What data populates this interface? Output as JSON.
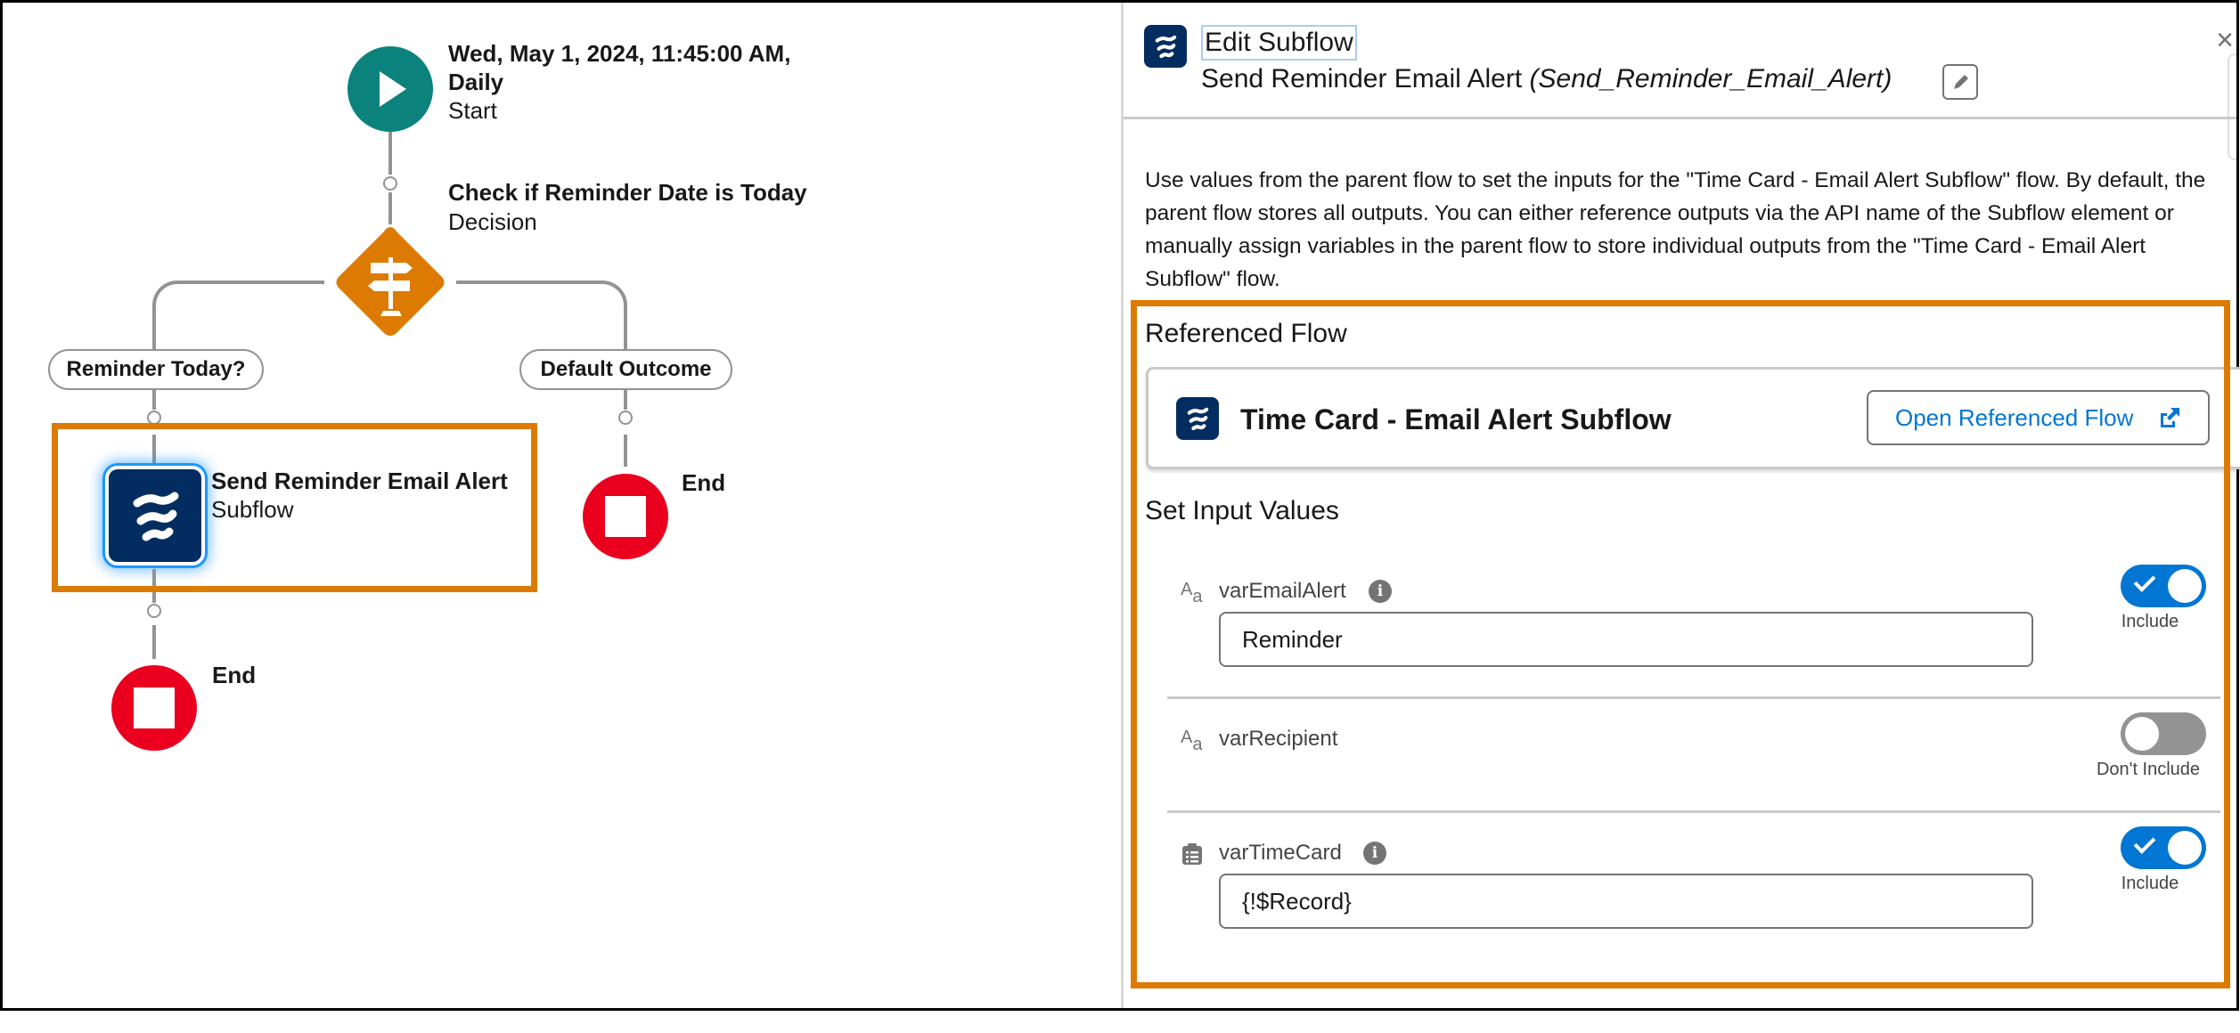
{
  "canvas": {
    "start": {
      "title_line1": "Wed, May 1, 2024, 11:45:00 AM,",
      "title_line2": "Daily",
      "type": "Start"
    },
    "decision": {
      "title": "Check if Reminder Date is Today",
      "type": "Decision"
    },
    "outcomes": [
      {
        "label": "Reminder Today?"
      },
      {
        "label": "Default Outcome"
      }
    ],
    "subflow": {
      "title": "Send Reminder Email Alert",
      "type": "Subflow",
      "highlighted": true
    },
    "end_right": {
      "label": "End"
    },
    "end_bottom": {
      "label": "End"
    }
  },
  "panel": {
    "title": "Edit Subflow",
    "element_label": "Send Reminder Email Alert",
    "element_api_name": "(Send_Reminder_Email_Alert)",
    "close_label": "×",
    "description": "Use values from the parent flow to set the inputs for the \"Time Card - Email Alert Subflow\" flow. By default, the parent flow stores all outputs. You can either reference outputs via the API name of the Subflow element or manually assign variables in the parent flow to store individual outputs from the \"Time Card - Email Alert Subflow\" flow.",
    "referenced_flow": {
      "heading": "Referenced Flow",
      "flow_name": "Time Card - Email Alert Subflow",
      "open_button": "Open Referenced Flow"
    },
    "inputs": {
      "heading": "Set Input Values",
      "items": [
        {
          "name": "varEmailAlert",
          "type_icon": "text-type-icon",
          "has_info": true,
          "value": "Reminder",
          "include": true,
          "toggle_label": "Include"
        },
        {
          "name": "varRecipient",
          "type_icon": "text-type-icon",
          "has_info": false,
          "value": null,
          "include": false,
          "toggle_label": "Don't Include"
        },
        {
          "name": "varTimeCard",
          "type_icon": "record-type-icon",
          "has_info": true,
          "value": "{!$Record}",
          "include": true,
          "toggle_label": "Include"
        }
      ]
    }
  },
  "colors": {
    "highlight": "#dd7a01",
    "start": "#0b827c",
    "decision": "#dd7a01",
    "end": "#ea001e",
    "subflow": "#032d60",
    "brand_blue": "#0176d3"
  }
}
